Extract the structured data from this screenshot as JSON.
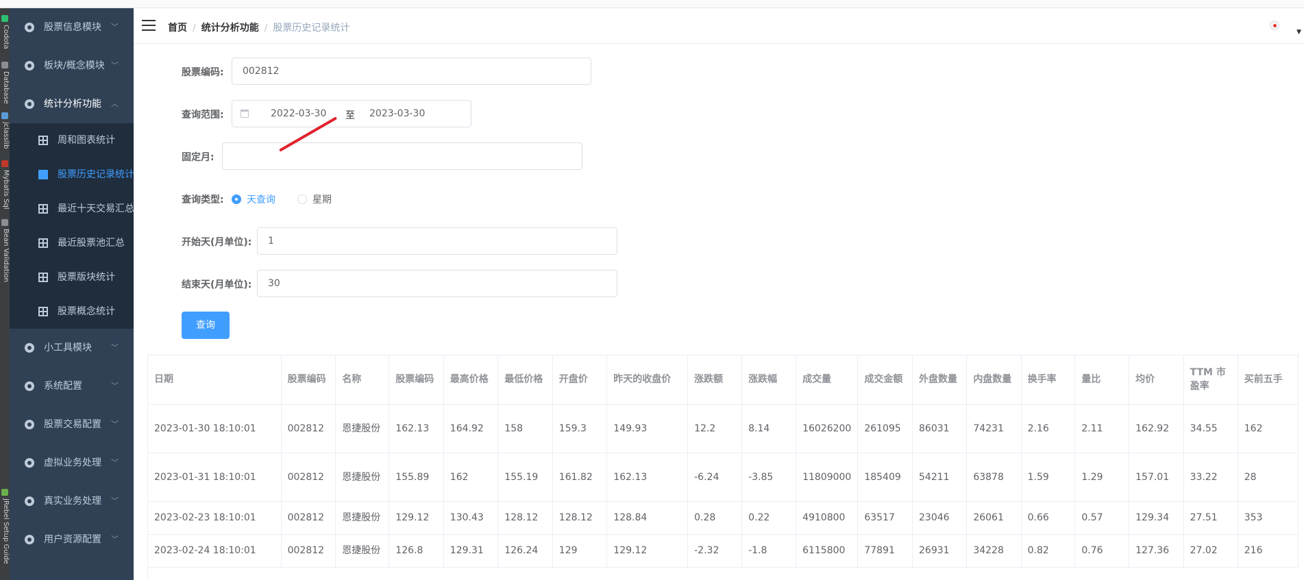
{
  "sidebar": {
    "menus_top": [
      {
        "label": "股票信息模块"
      },
      {
        "label": "板块/概念模块"
      }
    ],
    "open_menu": {
      "label": "统计分析功能"
    },
    "submenu": [
      {
        "label": "周和图表统计"
      },
      {
        "label": "股票历史记录统计"
      },
      {
        "label": "最近十天交易汇总"
      },
      {
        "label": "最近股票池汇总"
      },
      {
        "label": "股票版块统计"
      },
      {
        "label": "股票概念统计"
      }
    ],
    "menus_bottom": [
      {
        "label": "小工具模块"
      },
      {
        "label": "系统配置"
      },
      {
        "label": "股票交易配置"
      },
      {
        "label": "虚拟业务处理"
      },
      {
        "label": "真实业务处理"
      },
      {
        "label": "用户资源配置"
      }
    ]
  },
  "ide_strip": [
    "Codota",
    "Database",
    "jclasslib",
    "Mybatis Sql",
    "Bean Validation",
    "JRebel Setup Guide"
  ],
  "breadcrumb": {
    "home": "首页",
    "level2": "统计分析功能",
    "current": "股票历史记录统计"
  },
  "form": {
    "code_label": "股票编码:",
    "code_value": "002812",
    "range_label": "查询范围:",
    "range_start": "2022-03-30",
    "range_sep": "至",
    "range_end": "2023-03-30",
    "month_label": "固定月:",
    "month_value": "",
    "type_label": "查询类型:",
    "type_day": "天查询",
    "type_week": "星期",
    "type_selected": "天查询",
    "start_day_label": "开始天(月单位):",
    "start_day_value": "1",
    "end_day_label": "结束天(月单位):",
    "end_day_value": "30",
    "query_button": "查询"
  },
  "table": {
    "headers": [
      "日期",
      "股票编码",
      "名称",
      "股票编码",
      "最高价格",
      "最低价格",
      "开盘价",
      "昨天的收盘价",
      "涨跌额",
      "涨跌幅",
      "成交量",
      "成交金额",
      "外盘数量",
      "内盘数量",
      "换手率",
      "量比",
      "均价",
      "TTM 市盈率",
      "买前五手"
    ],
    "rows": [
      [
        "2023-01-30 18:10:01",
        "002812",
        "恩捷股份",
        "162.13",
        "164.92",
        "158",
        "159.3",
        "149.93",
        "12.2",
        "8.14",
        "16026200",
        "261095",
        "86031",
        "74231",
        "2.16",
        "2.11",
        "162.92",
        "34.55",
        "162"
      ],
      [
        "2023-01-31 18:10:01",
        "002812",
        "恩捷股份",
        "155.89",
        "162",
        "155.19",
        "161.82",
        "162.13",
        "-6.24",
        "-3.85",
        "11809000",
        "185409",
        "54211",
        "63878",
        "1.59",
        "1.29",
        "157.01",
        "33.22",
        "28"
      ],
      [
        "2023-02-23 18:10:01",
        "002812",
        "恩捷股份",
        "129.12",
        "130.43",
        "128.12",
        "128.12",
        "128.84",
        "0.28",
        "0.22",
        "4910800",
        "63517",
        "23046",
        "26061",
        "0.66",
        "0.57",
        "129.34",
        "27.51",
        "353"
      ],
      [
        "2023-02-24 18:10:01",
        "002812",
        "恩捷股份",
        "126.8",
        "129.31",
        "126.24",
        "129",
        "129.12",
        "-2.32",
        "-1.8",
        "6115800",
        "77891",
        "26931",
        "34228",
        "0.82",
        "0.76",
        "127.36",
        "27.02",
        "216"
      ]
    ]
  },
  "colors": {
    "sidebar_bg": "#304156",
    "submenu_bg": "#1f2d3d",
    "accent": "#409eff",
    "annotation": "#e0222d"
  }
}
